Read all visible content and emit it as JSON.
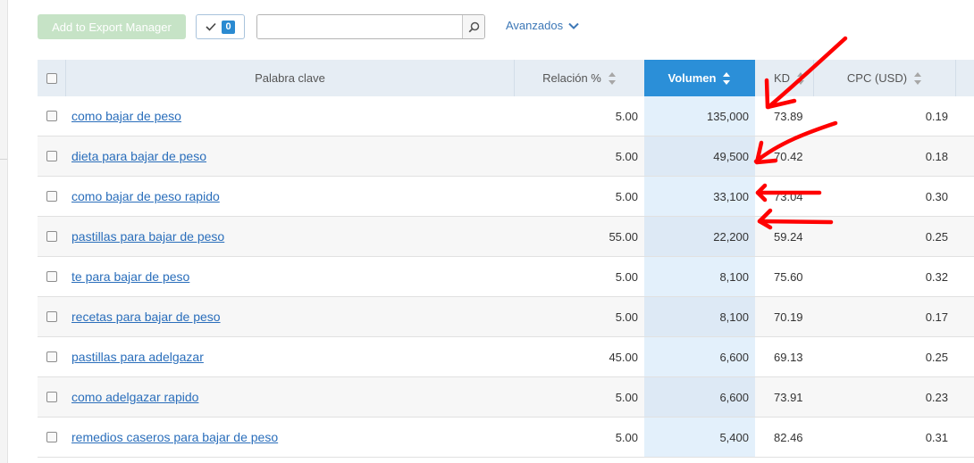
{
  "toolbar": {
    "export_button": "Add to Export Manager",
    "selected_count": "0",
    "search": {
      "value": "",
      "placeholder": ""
    },
    "advanced_label": "Avanzados"
  },
  "table": {
    "columns": {
      "keyword": "Palabra clave",
      "relation": "Relación %",
      "volume": "Volumen",
      "kd": "KD",
      "cpc": "CPC (USD)"
    },
    "rows": [
      {
        "keyword": "como bajar de peso",
        "relation": "5.00",
        "volume": "135,000",
        "kd": "73.89",
        "cpc": "0.19"
      },
      {
        "keyword": "dieta para bajar de peso",
        "relation": "5.00",
        "volume": "49,500",
        "kd": "70.42",
        "cpc": "0.18"
      },
      {
        "keyword": "como bajar de peso rapido",
        "relation": "5.00",
        "volume": "33,100",
        "kd": "73.04",
        "cpc": "0.30"
      },
      {
        "keyword": "pastillas para bajar de peso",
        "relation": "55.00",
        "volume": "22,200",
        "kd": "59.24",
        "cpc": "0.25"
      },
      {
        "keyword": "te para bajar de peso",
        "relation": "5.00",
        "volume": "8,100",
        "kd": "75.60",
        "cpc": "0.32"
      },
      {
        "keyword": "recetas para bajar de peso",
        "relation": "5.00",
        "volume": "8,100",
        "kd": "70.19",
        "cpc": "0.17"
      },
      {
        "keyword": "pastillas para adelgazar",
        "relation": "45.00",
        "volume": "6,600",
        "kd": "69.13",
        "cpc": "0.25"
      },
      {
        "keyword": "como adelgazar rapido",
        "relation": "5.00",
        "volume": "6,600",
        "kd": "73.91",
        "cpc": "0.23"
      },
      {
        "keyword": "remedios caseros para bajar de peso",
        "relation": "5.00",
        "volume": "5,400",
        "kd": "82.46",
        "cpc": "0.31"
      }
    ]
  },
  "colors": {
    "active_header": "#2b8fd8",
    "link": "#2a6ebb",
    "export_button": "#c6e3c6",
    "annotation": "#ff0000"
  }
}
